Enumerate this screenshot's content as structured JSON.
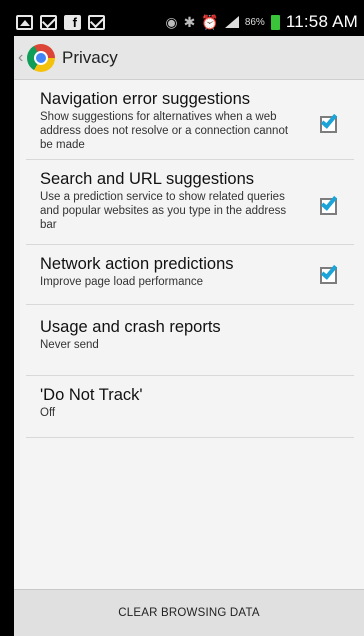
{
  "status_bar": {
    "battery_percent": "86%",
    "time": "11:58 AM",
    "icons": [
      "gallery-icon",
      "mail-icon",
      "facebook-icon",
      "mail-icon",
      "eye-icon",
      "bluetooth-icon",
      "alarm-icon",
      "signal-icon",
      "battery-icon"
    ]
  },
  "action_bar": {
    "title": "Privacy",
    "up_glyph": "‹"
  },
  "items": [
    {
      "title": "Navigation error suggestions",
      "summary": "Show suggestions for alternatives when a web address does not resolve or a connection cannot be made",
      "checked": true
    },
    {
      "title": "Search and URL suggestions",
      "summary": "Use a prediction service to show related queries and popular websites as you type in the address bar",
      "checked": true
    },
    {
      "title": "Network action predictions",
      "summary": "Improve page load performance",
      "checked": true
    },
    {
      "title": "Usage and crash reports",
      "summary": "Never send"
    },
    {
      "title": "'Do Not Track'",
      "summary": "Off"
    }
  ],
  "bottom_bar": {
    "button_label": "CLEAR BROWSING DATA"
  },
  "colors": {
    "accent_check": "#1aa4d8",
    "battery": "#3ac43a",
    "action_bar": "#e6e6e6",
    "content_bg": "#f4f4f4"
  }
}
